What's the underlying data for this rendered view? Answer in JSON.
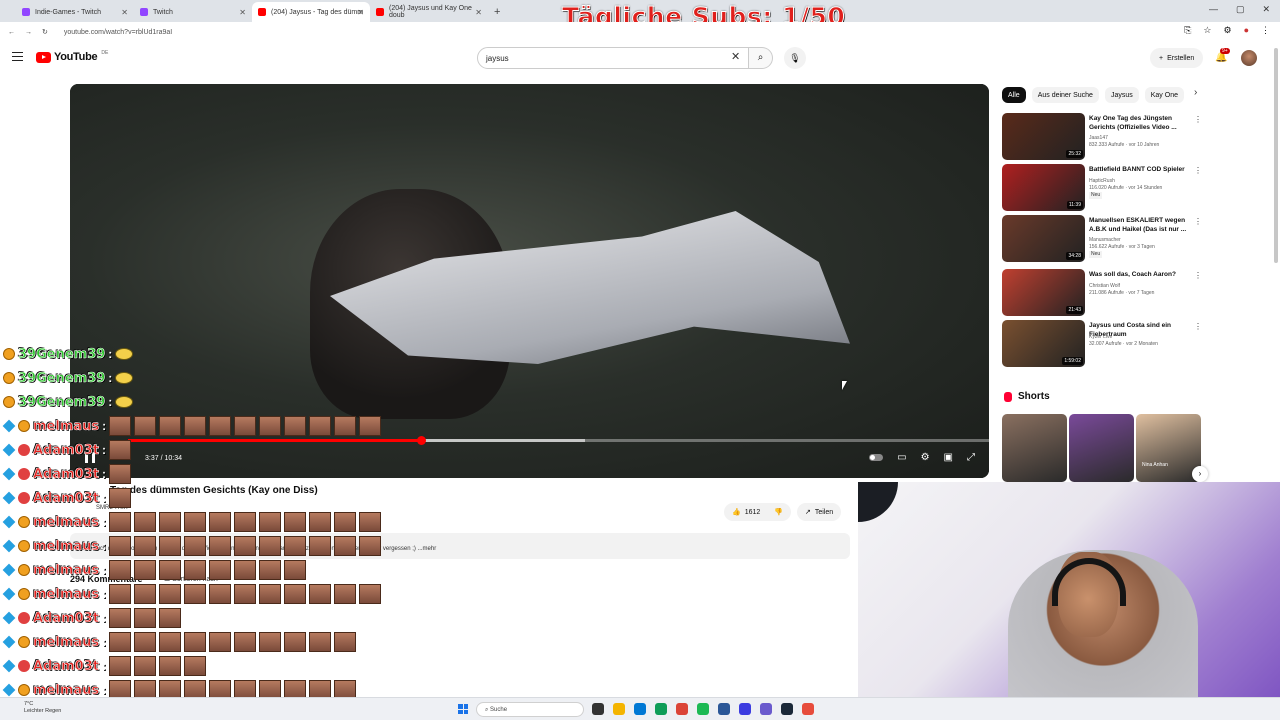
{
  "browser": {
    "tabs": [
      {
        "label": "Indie-Games - Twitch",
        "color": "#9146ff",
        "active": false
      },
      {
        "label": "Twitch",
        "color": "#9146ff",
        "active": false
      },
      {
        "label": "(204) Jaysus - Tag des dümm",
        "color": "#ff0000",
        "active": true
      },
      {
        "label": "(204) Jaysus und Kay One doub",
        "color": "#ff0000",
        "active": false
      }
    ],
    "url": "youtube.com/watch?v=rblUd1ra9aI"
  },
  "overlay_title": "Tägliche Subs: 1/50",
  "youtube": {
    "logo_text": "YouTube",
    "logo_region": "DE",
    "search_value": "jaysus",
    "create_label": "Erstellen",
    "notif_count": "9+"
  },
  "player": {
    "time": "3:37 / 10:34",
    "progress": 0.34,
    "buffered": 0.53
  },
  "video": {
    "title": "Tag des dümmsten Gesichts (Kay one Diss)",
    "channel": "SMRL TRIX",
    "likes": "1612",
    "share_label": "Teilen",
    "description": "Wenn euch das Video gefallen hat, gibt diesem Video einen Daumen noch Danke fürs zuschauen Abbonieren nicht vergessen ;) ...mehr",
    "comments_header": "294 Kommentare",
    "sort_label": "Sortieren nach"
  },
  "chips": [
    "Alle",
    "Aus deiner Suche",
    "Jaysus",
    "Kay One"
  ],
  "recommendations": [
    {
      "title": "Kay One Tag des Jüngsten Gerichts (Offizielles Video ...",
      "channel": "Jaas147",
      "meta": "832.333 Aufrufe · vor 10 Jahren",
      "duration": "25:32",
      "new": "",
      "thumb": "#5a2a1a"
    },
    {
      "title": "Battlefield BANNT COD Spieler",
      "channel": "HapticRush",
      "meta": "116.020 Aufrufe · vor 14 Stunden",
      "duration": "11:39",
      "new": "Neu",
      "thumb": "#b02020"
    },
    {
      "title": "Manuellsen ESKALIERT wegen A.B.K und Haikel (Das ist nur ...",
      "channel": "Manusmacher",
      "meta": "156.622 Aufrufe · vor 3 Tagen",
      "duration": "34:28",
      "new": "Neu",
      "thumb": "#6a3a2a"
    },
    {
      "title": "Was soll das, Coach Aaron?",
      "channel": "Christian Wolf",
      "meta": "211.086 Aufrufe · vor 7 Tagen",
      "duration": "21:43",
      "new": "",
      "thumb": "#c04030"
    },
    {
      "title": "Jaysus und Costa sind ein Fiebertraum",
      "channel": "Kyzer Live",
      "meta": "32.007 Aufrufe · vor 2 Monaten",
      "duration": "1:59:02",
      "new": "",
      "thumb": "#7a5030"
    }
  ],
  "shorts_label": "Shorts",
  "shorts": [
    {
      "color": "#8a7060",
      "caption": ""
    },
    {
      "color": "#7a4a9a",
      "caption": ""
    },
    {
      "color": "#e0c0a0",
      "caption": "Nina Anhan"
    }
  ],
  "chat": [
    {
      "user": "39Genem39",
      "color": "#2fc42f",
      "emotes": 0,
      "yellow": true,
      "badges": [
        "gold"
      ]
    },
    {
      "user": "39Genem39",
      "color": "#2fc42f",
      "emotes": 0,
      "yellow": true,
      "badges": [
        "gold"
      ]
    },
    {
      "user": "39Genem39",
      "color": "#2fc42f",
      "emotes": 0,
      "yellow": true,
      "badges": [
        "gold"
      ]
    },
    {
      "user": "melmaus",
      "color": "#e0201c",
      "emotes": 11,
      "yellow": false,
      "badges": [
        "blue",
        "gold"
      ]
    },
    {
      "user": "Adam03t",
      "color": "#e0201c",
      "emotes": 1,
      "yellow": false,
      "badges": [
        "blue",
        "red"
      ]
    },
    {
      "user": "Adam03t",
      "color": "#e0201c",
      "emotes": 1,
      "yellow": false,
      "badges": [
        "blue",
        "red"
      ]
    },
    {
      "user": "Adam03t",
      "color": "#e0201c",
      "emotes": 1,
      "yellow": false,
      "badges": [
        "blue",
        "red"
      ]
    },
    {
      "user": "melmaus",
      "color": "#e0201c",
      "emotes": 11,
      "yellow": false,
      "badges": [
        "blue",
        "gold"
      ]
    },
    {
      "user": "melmaus",
      "color": "#e0201c",
      "emotes": 11,
      "yellow": false,
      "badges": [
        "blue",
        "gold"
      ]
    },
    {
      "user": "melmaus",
      "color": "#e0201c",
      "emotes": 8,
      "yellow": false,
      "badges": [
        "blue",
        "gold"
      ]
    },
    {
      "user": "melmaus",
      "color": "#e0201c",
      "emotes": 11,
      "yellow": false,
      "badges": [
        "blue",
        "gold"
      ]
    },
    {
      "user": "Adam03t",
      "color": "#e0201c",
      "emotes": 3,
      "yellow": false,
      "badges": [
        "blue",
        "red"
      ]
    },
    {
      "user": "melmaus",
      "color": "#e0201c",
      "emotes": 10,
      "yellow": false,
      "badges": [
        "blue",
        "gold"
      ]
    },
    {
      "user": "Adam03t",
      "color": "#e0201c",
      "emotes": 4,
      "yellow": false,
      "badges": [
        "blue",
        "red"
      ]
    },
    {
      "user": "melmaus",
      "color": "#e0201c",
      "emotes": 10,
      "yellow": false,
      "badges": [
        "blue",
        "gold"
      ]
    }
  ],
  "taskbar": {
    "weather_temp": "7°C",
    "weather_text": "Leichter Regen",
    "search_placeholder": "Suche",
    "apps": [
      "#333333",
      "#f4b400",
      "#0078d4",
      "#0f9d58",
      "#db4437",
      "#1db954",
      "#2b5797",
      "#3c3ce0",
      "#6a5acd",
      "#1b2838",
      "#e74c3c"
    ]
  }
}
